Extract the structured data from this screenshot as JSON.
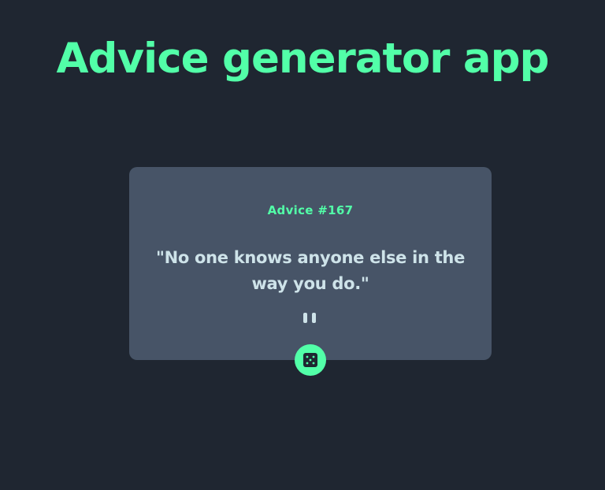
{
  "header": {
    "title": "Advice generator app"
  },
  "card": {
    "advice_id": "Advice #167",
    "advice_text": "\"No one knows anyone else in the way you do.\""
  },
  "controls": {
    "dice_icon": "dice-icon"
  },
  "colors": {
    "background": "#1f2631",
    "card": "#475467",
    "accent": "#52ffa8",
    "text": "#cee3e9"
  }
}
